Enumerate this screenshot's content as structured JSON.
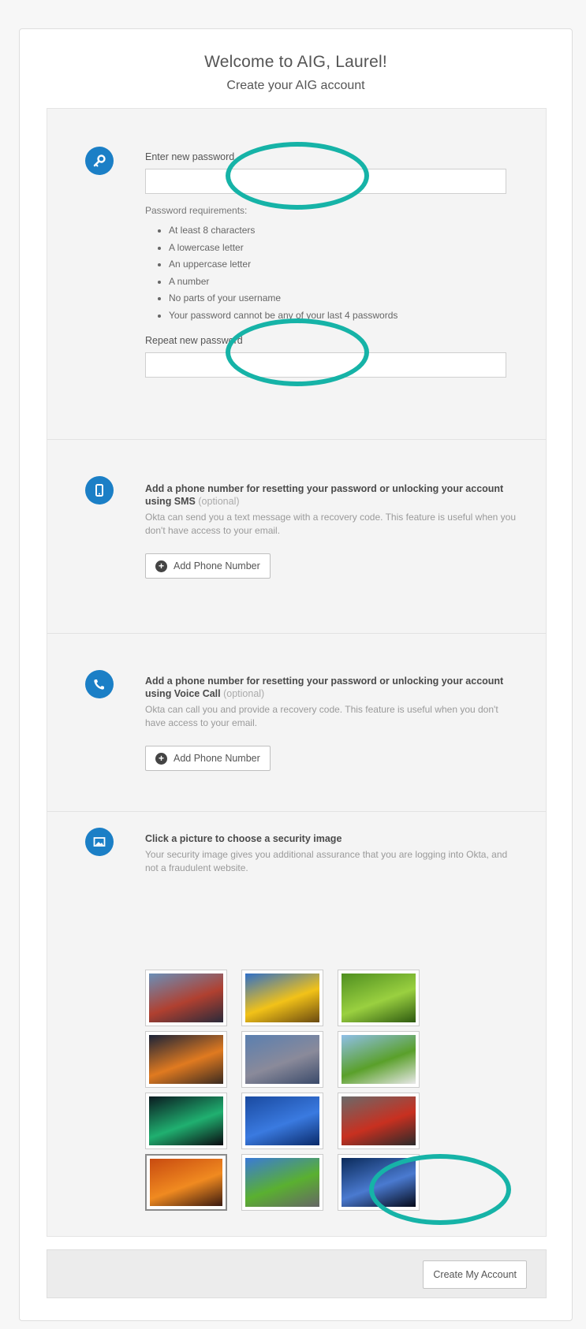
{
  "header": {
    "title": "Welcome to AIG, Laurel!",
    "subtitle": "Create your AIG account"
  },
  "password": {
    "new_label": "Enter new password",
    "new_value": "",
    "requirements_label": "Password requirements:",
    "requirements": [
      "At least 8 characters",
      "A lowercase letter",
      "An uppercase letter",
      "A number",
      "No parts of your username",
      "Your password cannot be any of your last 4 passwords"
    ],
    "repeat_label": "Repeat new password",
    "repeat_value": ""
  },
  "sms": {
    "heading": "Add a phone number for resetting your password or unlocking your account using SMS",
    "optional": "(optional)",
    "description": "Okta can send you a text message with a recovery code. This feature is useful when you don't have access to your email.",
    "button_label": "Add Phone Number"
  },
  "voice": {
    "heading": "Add a phone number for resetting your password or unlocking your account using Voice Call",
    "optional": "(optional)",
    "description": "Okta can call you and provide a recovery code. This feature is useful when you don't have access to your email.",
    "button_label": "Add Phone Number"
  },
  "security_image": {
    "heading": "Click a picture to choose a security image",
    "description": "Your security image gives you additional assurance that you are logging into Okta, and not a fraudulent website.",
    "images": [
      {
        "icon": "golden-gate-bridge",
        "colors": [
          "#6a8fb8",
          "#b04030",
          "#2a2a3a"
        ]
      },
      {
        "icon": "sunflower",
        "colors": [
          "#2f6fc8",
          "#f2c218",
          "#6a4a10"
        ]
      },
      {
        "icon": "green-succulent",
        "colors": [
          "#4f8f20",
          "#9ad040",
          "#2e5a10"
        ]
      },
      {
        "icon": "bridge-at-night",
        "colors": [
          "#1a2238",
          "#e07a20",
          "#3a2a20"
        ]
      },
      {
        "icon": "brooklyn-bridge",
        "colors": [
          "#5a7fb0",
          "#8a8a9a",
          "#3a4a6a"
        ]
      },
      {
        "icon": "sheep-on-grass",
        "colors": [
          "#8fbfe8",
          "#5aa02a",
          "#e8e8e8"
        ]
      },
      {
        "icon": "aurora",
        "colors": [
          "#0a1a20",
          "#20b070",
          "#0a0a10"
        ]
      },
      {
        "icon": "blue-network",
        "colors": [
          "#1a4aa0",
          "#3a7ae0",
          "#0a2a6a"
        ]
      },
      {
        "icon": "red-robot",
        "colors": [
          "#6a6a6a",
          "#c83020",
          "#2a2a2a"
        ]
      },
      {
        "icon": "orange-sunset",
        "colors": [
          "#c84a10",
          "#f08a20",
          "#3a1a10"
        ]
      },
      {
        "icon": "road-and-sky",
        "colors": [
          "#3a7ad8",
          "#5ab030",
          "#666666"
        ]
      },
      {
        "icon": "stingray",
        "colors": [
          "#0a2a5a",
          "#4a7ad0",
          "#050a1a"
        ]
      }
    ],
    "selected_index": 9
  },
  "footer": {
    "create_button": "Create My Account"
  },
  "colors": {
    "accent": "#1b7fc6",
    "annotation": "#16b3a7"
  }
}
